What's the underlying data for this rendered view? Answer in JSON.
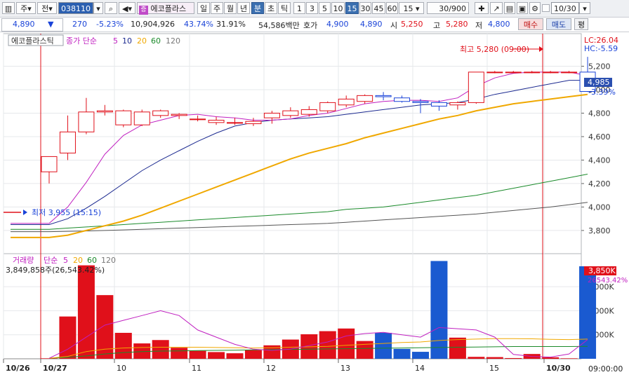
{
  "toolbar": {
    "market": "주",
    "period_type": "전",
    "code": "038110",
    "stock_name": "에코플라스",
    "period_tabs": [
      "일",
      "주",
      "월",
      "년",
      "분",
      "초",
      "틱"
    ],
    "selected_period_tab": "분",
    "minute_tabs": [
      "1",
      "3",
      "5",
      "10",
      "15",
      "30",
      "45",
      "60"
    ],
    "selected_minute_tab": "15",
    "minute_select": "15",
    "count": "30/900",
    "date": "10/30"
  },
  "quote": {
    "price": "4,890",
    "direction": "▼",
    "change": "270",
    "change_rate": "-5.23%",
    "volume": "10,904,926",
    "volume_ratio": "43.74%",
    "turnover": "31.91%",
    "amount": "54,586백만",
    "bid_label": "호가",
    "ask_price": "4,900",
    "bid_price": "4,890",
    "open_label": "시",
    "open": "5,250",
    "high_label": "고",
    "high": "5,280",
    "low_label": "저",
    "low": "4,800",
    "buy_button": "매수",
    "sell_button": "매도",
    "eval_button": "평"
  },
  "price_panel": {
    "stock_tag": "에코플라스틱",
    "ma_title": "종가 단순",
    "ma_periods": [
      "5",
      "10",
      "20",
      "60",
      "120"
    ],
    "ma_colors": [
      "#c020c0",
      "#1c2a90",
      "#f0a800",
      "#1a8a2a",
      "#555555"
    ],
    "lc_label": "LC:26.04",
    "hc_label": "HC:-5.59",
    "current_price_tag": "4,985",
    "current_change_tag": "-3.39%",
    "high_marker": "최고 5,280 (09:00)",
    "low_marker": "최저 3,955 (15:15)",
    "y_ticks": [
      "5,200",
      "5,000",
      "4,800",
      "4,600",
      "4,400",
      "4,200",
      "4,000",
      "3,800"
    ],
    "y_range": [
      3650,
      5430
    ]
  },
  "volume_panel": {
    "title": "거래량",
    "ma_title": "단순",
    "ma_periods": [
      "5",
      "20",
      "60",
      "120"
    ],
    "info": "3,849,858주(26,543.42%)",
    "current_tag": "3,850K",
    "current_ratio_tag": "26543.42%",
    "y_ticks": [
      "3,000K",
      "2,000K",
      "1,000K"
    ],
    "y_range": [
      0,
      4200
    ]
  },
  "x_axis": {
    "labels": [
      "10/26",
      "10/27",
      "10",
      "11",
      "12",
      "13",
      "14",
      "15",
      "10/30"
    ],
    "time_tag": "09:00:00"
  },
  "chart_data": {
    "type": "candlestick",
    "candles": [
      {
        "o": 4300,
        "h": 4400,
        "l": 4200,
        "c": 4430
      },
      {
        "o": 4460,
        "h": 4780,
        "l": 4400,
        "c": 4640
      },
      {
        "o": 4640,
        "h": 4930,
        "l": 4620,
        "c": 4810
      },
      {
        "o": 4810,
        "h": 4870,
        "l": 4780,
        "c": 4820
      },
      {
        "o": 4700,
        "h": 4830,
        "l": 4680,
        "c": 4820
      },
      {
        "o": 4700,
        "h": 4830,
        "l": 4690,
        "c": 4810
      },
      {
        "o": 4780,
        "h": 4830,
        "l": 4760,
        "c": 4820
      },
      {
        "o": 4780,
        "h": 4800,
        "l": 4750,
        "c": 4790
      },
      {
        "o": 4750,
        "h": 4780,
        "l": 4730,
        "c": 4750
      },
      {
        "o": 4720,
        "h": 4770,
        "l": 4700,
        "c": 4740
      },
      {
        "o": 4720,
        "h": 4760,
        "l": 4700,
        "c": 4720
      },
      {
        "o": 4710,
        "h": 4760,
        "l": 4690,
        "c": 4730
      },
      {
        "o": 4760,
        "h": 4820,
        "l": 4710,
        "c": 4800
      },
      {
        "o": 4780,
        "h": 4850,
        "l": 4760,
        "c": 4820
      },
      {
        "o": 4790,
        "h": 4860,
        "l": 4770,
        "c": 4830
      },
      {
        "o": 4820,
        "h": 4900,
        "l": 4800,
        "c": 4890
      },
      {
        "o": 4870,
        "h": 4950,
        "l": 4850,
        "c": 4920
      },
      {
        "o": 4900,
        "h": 4960,
        "l": 4880,
        "c": 4950
      },
      {
        "o": 4950,
        "h": 4980,
        "l": 4910,
        "c": 4940
      },
      {
        "o": 4930,
        "h": 4950,
        "l": 4890,
        "c": 4900
      },
      {
        "o": 4900,
        "h": 4920,
        "l": 4800,
        "c": 4890
      },
      {
        "o": 4890,
        "h": 4910,
        "l": 4820,
        "c": 4860
      },
      {
        "o": 4870,
        "h": 4900,
        "l": 4830,
        "c": 4890
      },
      {
        "o": 4890,
        "h": 5150,
        "l": 4880,
        "c": 5150
      },
      {
        "o": 5150,
        "h": 5160,
        "l": 5140,
        "c": 5150
      },
      {
        "o": 5150,
        "h": 5160,
        "l": 5140,
        "c": 5150
      },
      {
        "o": 5150,
        "h": 5160,
        "l": 5140,
        "c": 5150
      },
      {
        "o": 5150,
        "h": 5160,
        "l": 5140,
        "c": 5150
      },
      {
        "o": 5150,
        "h": 5160,
        "l": 5140,
        "c": 5150
      },
      {
        "o": 5150,
        "h": 5280,
        "l": 4980,
        "c": 4985
      }
    ],
    "volumes": [
      20,
      1760,
      3890,
      2650,
      1080,
      640,
      780,
      460,
      330,
      280,
      230,
      360,
      560,
      800,
      1020,
      1150,
      1260,
      740,
      1080,
      410,
      290,
      4070,
      880,
      80,
      70,
      30,
      200,
      60,
      20,
      3850
    ],
    "ma5": [
      3860,
      4000,
      4210,
      4450,
      4610,
      4700,
      4740,
      4780,
      4790,
      4770,
      4760,
      4740,
      4740,
      4750,
      4780,
      4800,
      4840,
      4880,
      4900,
      4910,
      4910,
      4900,
      4930,
      5030,
      5100,
      5140,
      5150,
      5150,
      5150,
      5120
    ],
    "ma10": [
      3850,
      3900,
      3990,
      4090,
      4200,
      4310,
      4400,
      4480,
      4560,
      4630,
      4690,
      4720,
      4740,
      4750,
      4760,
      4770,
      4790,
      4810,
      4830,
      4850,
      4870,
      4880,
      4890,
      4920,
      4960,
      4990,
      5020,
      5050,
      5080,
      5080
    ],
    "ma20": [
      3740,
      3760,
      3800,
      3840,
      3880,
      3930,
      3990,
      4050,
      4110,
      4170,
      4230,
      4290,
      4350,
      4410,
      4460,
      4500,
      4540,
      4590,
      4630,
      4670,
      4710,
      4750,
      4780,
      4820,
      4850,
      4880,
      4900,
      4920,
      4940,
      4960
    ],
    "ma60": [
      3810,
      3820,
      3830,
      3840,
      3850,
      3860,
      3870,
      3880,
      3890,
      3900,
      3910,
      3920,
      3930,
      3940,
      3950,
      3960,
      3980,
      3990,
      4000,
      4020,
      4040,
      4060,
      4080,
      4100,
      4130,
      4160,
      4190,
      4220,
      4250,
      4280
    ],
    "ma120": [
      3790,
      3793,
      3796,
      3800,
      3805,
      3810,
      3815,
      3820,
      3825,
      3830,
      3835,
      3840,
      3845,
      3850,
      3855,
      3860,
      3870,
      3880,
      3890,
      3900,
      3910,
      3920,
      3930,
      3940,
      3955,
      3970,
      3985,
      4000,
      4020,
      4040
    ],
    "vol_ma5": [
      20,
      400,
      900,
      1400,
      1600,
      1800,
      2000,
      1800,
      1200,
      900,
      600,
      400,
      350,
      400,
      550,
      700,
      950,
      1050,
      1100,
      1000,
      900,
      1300,
      1250,
      1200,
      900,
      180,
      100,
      70,
      200,
      800
    ],
    "vol_ma20": [
      20,
      100,
      300,
      400,
      450,
      470,
      480,
      480,
      480,
      470,
      460,
      450,
      460,
      480,
      500,
      520,
      560,
      600,
      640,
      680,
      700,
      760,
      800,
      820,
      840,
      840,
      830,
      810,
      800,
      820
    ],
    "vol_ma60": [
      20,
      60,
      120,
      200,
      260,
      300,
      320,
      330,
      340,
      350,
      360,
      370,
      380,
      390,
      400,
      410,
      420,
      430,
      440,
      450,
      460,
      470,
      480,
      490,
      500,
      510,
      510,
      510,
      510,
      520
    ]
  }
}
